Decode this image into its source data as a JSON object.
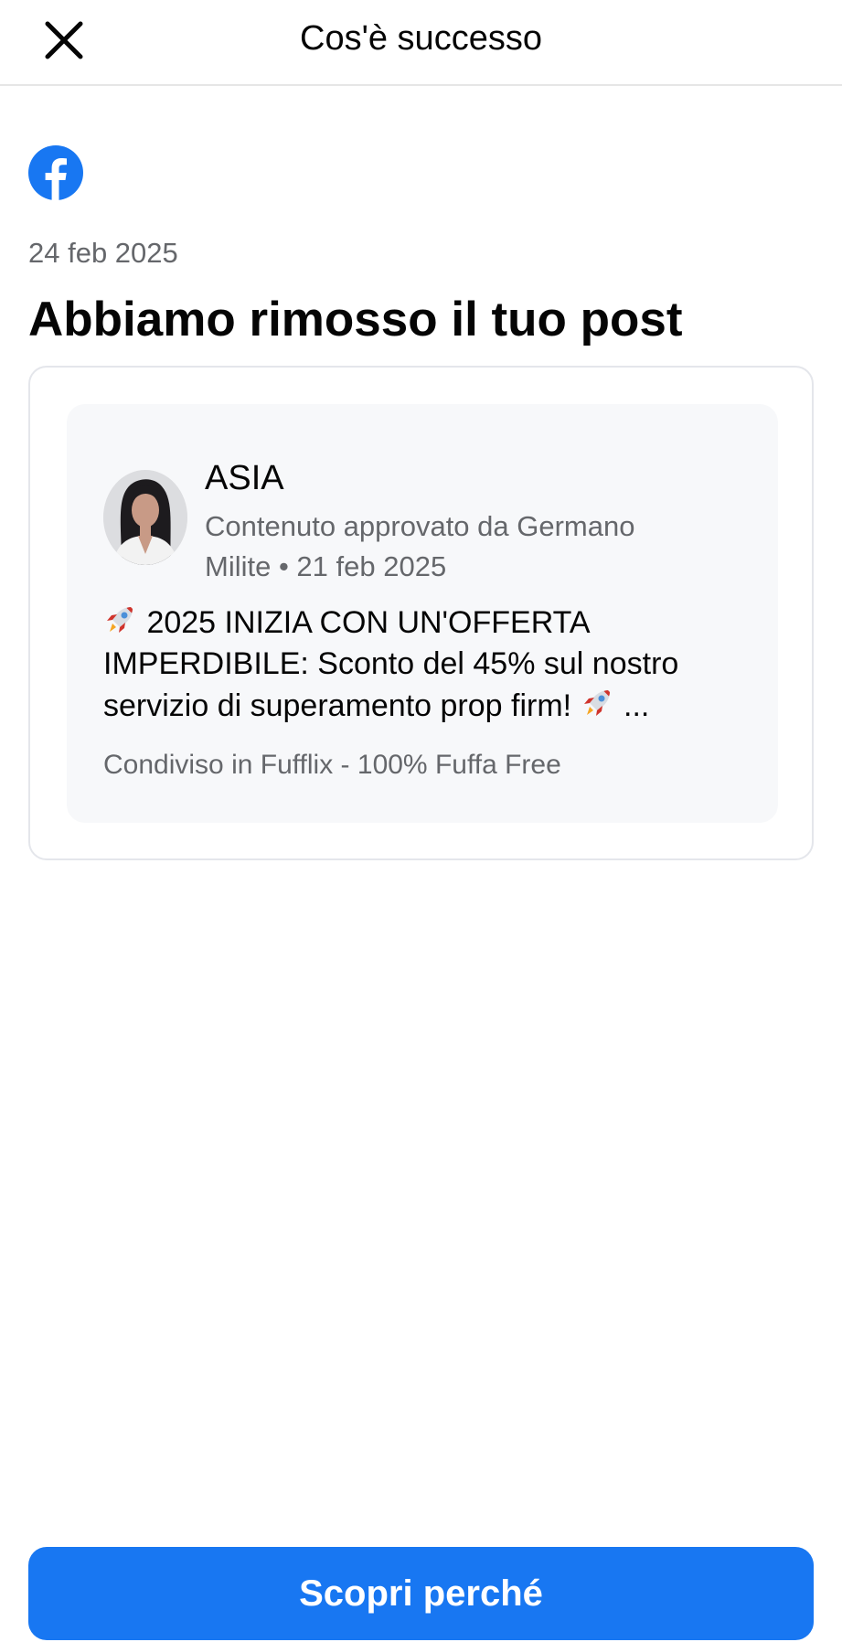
{
  "header": {
    "title": "Cos'è successo",
    "close_icon": "close-icon"
  },
  "notice": {
    "logo_icon": "facebook-logo-icon",
    "date": "24 feb 2025",
    "headline": "Abbiamo rimosso il tuo post"
  },
  "post": {
    "author": "ASIA",
    "meta_line1": "Contenuto approvato da Germano",
    "meta_line2": "Milite • 21 feb 2025",
    "text_line1": "2025 INIZIA CON UN'OFFERTA",
    "text_line2": "IMPERDIBILE: Sconto del 45% sul nostro",
    "text_line3": "servizio di superamento prop firm!",
    "text_ellipsis": "...",
    "emoji_icon": "rocket-icon",
    "shared_in": "Condiviso in Fufflix - 100% Fuffa Free"
  },
  "cta": {
    "label": "Scopri perché"
  },
  "colors": {
    "brand_blue": "#1877f2",
    "secondary_text": "#65676b",
    "card_background": "#f7f8fa"
  }
}
